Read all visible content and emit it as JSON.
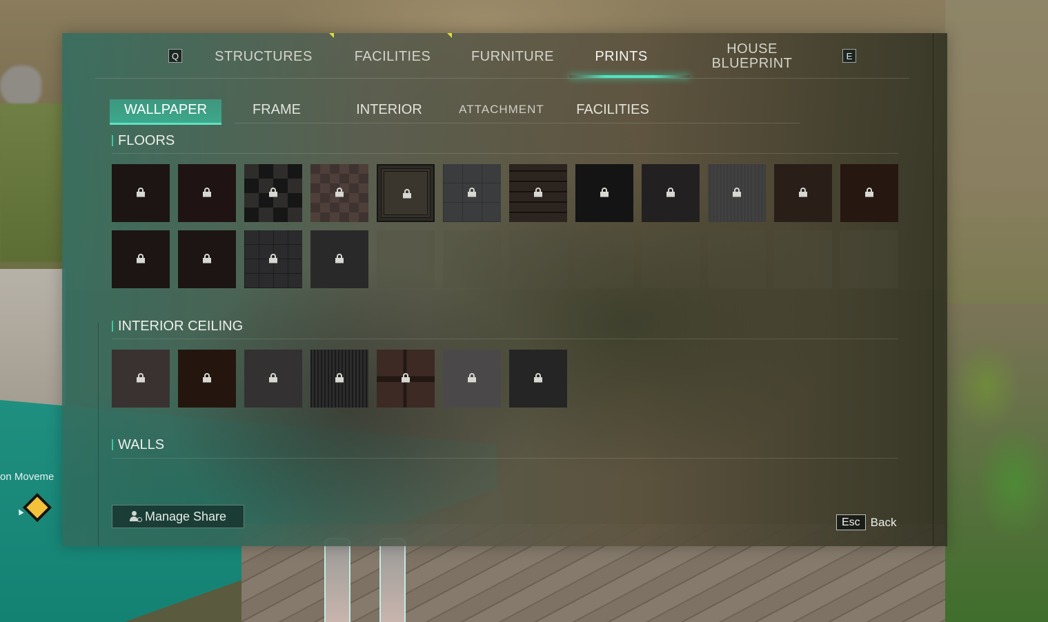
{
  "hud": {
    "objective_text": "on Moveme",
    "marker_icon": "diamond-waypoint-icon",
    "marker_color": "#f4c13a"
  },
  "top_nav": {
    "prev_key": "Q",
    "next_key": "E",
    "tabs": [
      {
        "label": "STRUCTURES",
        "active": false,
        "has_notification": true
      },
      {
        "label": "FACILITIES",
        "active": false,
        "has_notification": true
      },
      {
        "label": "FURNITURE",
        "active": false,
        "has_notification": false
      },
      {
        "label": "PRINTS",
        "active": true,
        "has_notification": false
      },
      {
        "label": "HOUSE\nBLUEPRINT",
        "label_line1": "HOUSE",
        "label_line2": "BLUEPRINT",
        "active": false,
        "has_notification": false
      }
    ],
    "accent_color": "#4fe5c0",
    "notification_color": "#d9e23a"
  },
  "sub_nav": {
    "tabs": [
      {
        "label": "WALLPAPER",
        "active": true
      },
      {
        "label": "FRAME",
        "active": false
      },
      {
        "label": "INTERIOR",
        "active": false
      },
      {
        "label": "ATTACHMENT",
        "active": false
      },
      {
        "label": "FACILITIES",
        "active": false
      }
    ]
  },
  "sections": {
    "floors": {
      "title": "FLOORS",
      "items": [
        {
          "texture": "dark",
          "locked": true
        },
        {
          "texture": "dark-red",
          "locked": true
        },
        {
          "texture": "checker",
          "locked": true
        },
        {
          "texture": "brown-checker",
          "locked": true
        },
        {
          "texture": "framed",
          "locked": true
        },
        {
          "texture": "slate",
          "locked": true
        },
        {
          "texture": "planks",
          "locked": true
        },
        {
          "texture": "black",
          "locked": true
        },
        {
          "texture": "charcoal",
          "locked": true
        },
        {
          "texture": "gray-noise",
          "locked": true
        },
        {
          "texture": "brown",
          "locked": true
        },
        {
          "texture": "deep-brown",
          "locked": true
        },
        {
          "texture": "dark",
          "locked": true
        },
        {
          "texture": "dark",
          "locked": true
        },
        {
          "texture": "stone-block",
          "locked": true
        },
        {
          "texture": "gray-flat",
          "locked": true
        }
      ],
      "empty_slots": 8
    },
    "interior_ceiling": {
      "title": "INTERIOR CEILING",
      "items": [
        {
          "texture": "warm-gray",
          "locked": true
        },
        {
          "texture": "dark-brown",
          "locked": true
        },
        {
          "texture": "gray",
          "locked": true
        },
        {
          "texture": "stripes",
          "locked": true
        },
        {
          "texture": "wood-cross",
          "locked": true
        },
        {
          "texture": "light-gray",
          "locked": true
        },
        {
          "texture": "charcoal",
          "locked": true
        }
      ]
    },
    "walls": {
      "title": "WALLS",
      "items": []
    }
  },
  "footer": {
    "manage_share_label": "Manage Share",
    "manage_share_icon": "person-gear-icon",
    "back_key": "Esc",
    "back_label": "Back"
  }
}
